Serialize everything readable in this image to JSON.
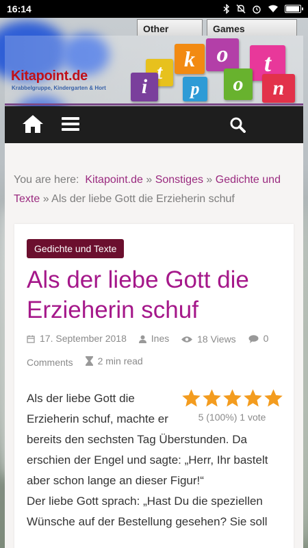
{
  "status_bar": {
    "time": "16:14"
  },
  "top_tabs": [
    "Other",
    "Games"
  ],
  "header": {
    "logo_title": "Kitapoint.de",
    "logo_subtitle": "Krabbelgruppe, Kindergarten & Hort",
    "cube_letters": [
      "t",
      "k",
      "o",
      "t",
      "i",
      "p",
      "o",
      "n"
    ]
  },
  "nav": {
    "home_icon": "home-icon",
    "menu_icon": "hamburger-menu-icon",
    "search_icon": "search-icon"
  },
  "breadcrumb": {
    "prefix": "You are here:",
    "items": [
      "Kitapoint.de",
      "Sonstiges",
      "Gedichte und Texte"
    ],
    "separator": "»",
    "current": "Als der liebe Gott die Erzieherin schuf"
  },
  "post": {
    "category": "Gedichte und Texte",
    "title": "Als der liebe Gott die Erzieherin schuf",
    "meta": {
      "date": "17. September 2018",
      "author": "Ines",
      "views": "18 Views",
      "comments_count": "0",
      "comments_label": "Comments",
      "read_time": "2 min read"
    },
    "rating": {
      "stars": 5,
      "max": 5,
      "text": "5 (100%) 1 vote",
      "star_color": "#f39c1f"
    },
    "paragraphs": [
      "Als der liebe Gott die Erzieherin schuf, machte er bereits den sechsten Tag Überstunden. Da erschien der Engel und sagte: „Herr, Ihr bastelt aber schon lange an dieser Figur!“",
      "Der liebe Gott sprach: „Hast Du die speziellen Wünsche auf der Bestellung gesehen? Sie soll"
    ]
  },
  "colors": {
    "accent": "#a5188a",
    "badge": "#6b0f2e",
    "nav": "#1e1e1e",
    "link": "#9a2a7f"
  }
}
